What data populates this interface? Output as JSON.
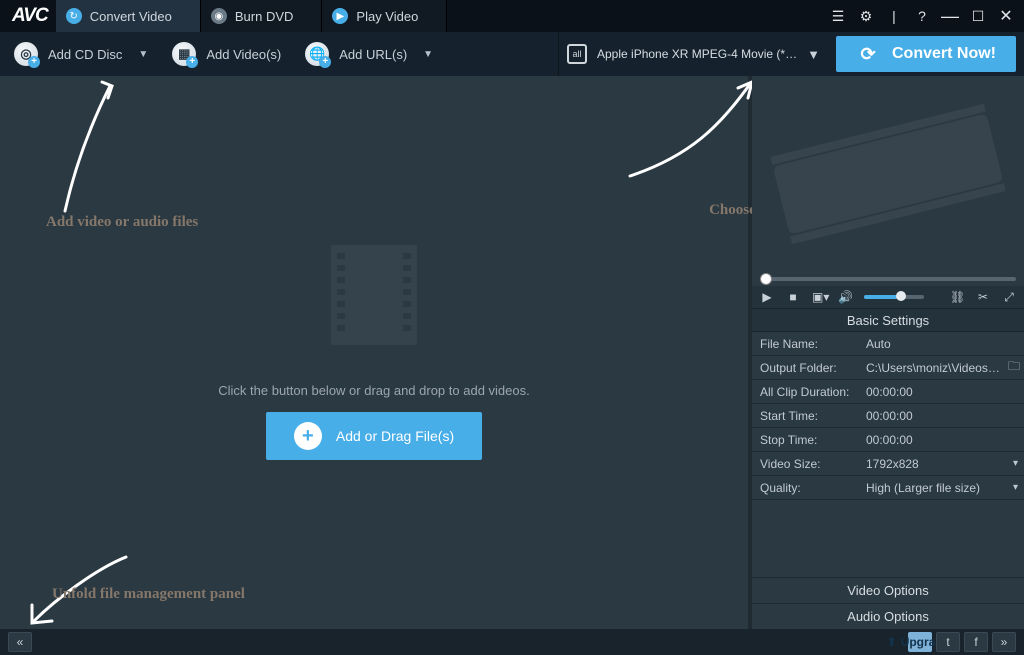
{
  "titlebar": {
    "logo": "AVC",
    "tabs": [
      {
        "label": "Convert Video",
        "active": true
      },
      {
        "label": "Burn DVD",
        "active": false
      },
      {
        "label": "Play Video",
        "active": false
      }
    ]
  },
  "toolbar": {
    "add_cd": "Add CD Disc",
    "add_video": "Add Video(s)",
    "add_url": "Add URL(s)",
    "profile": "Apple iPhone XR MPEG-4 Movie (*.m…",
    "profile_prefix": "all",
    "convert": "Convert Now!"
  },
  "main": {
    "dropzone_hint": "Click the button below or drag and drop to add videos.",
    "add_button": "Add or Drag File(s)"
  },
  "annotations": {
    "left": "Add video or audio files",
    "right": "Choose output profile and convert",
    "bottom": "Unfold file management panel"
  },
  "settings": {
    "title": "Basic Settings",
    "rows": {
      "file_name_label": "File Name:",
      "file_name_value": "Auto",
      "output_folder_label": "Output Folder:",
      "output_folder_value": "C:\\Users\\moniz\\Videos…",
      "duration_label": "All Clip Duration:",
      "duration_value": "00:00:00",
      "start_label": "Start Time:",
      "start_value": "00:00:00",
      "stop_label": "Stop Time:",
      "stop_value": "00:00:00",
      "size_label": "Video Size:",
      "size_value": "1792x828",
      "quality_label": "Quality:",
      "quality_value": "High (Larger file size)"
    },
    "video_options": "Video Options",
    "audio_options": "Audio Options"
  },
  "footer": {
    "upgrade": "Upgrade"
  }
}
